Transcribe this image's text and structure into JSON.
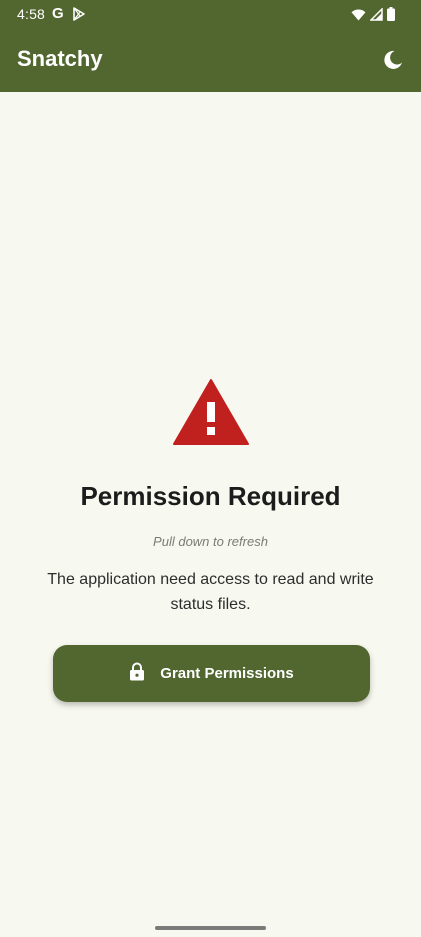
{
  "status_bar": {
    "time": "4:58",
    "left_icons": [
      "google-g-icon",
      "play-store-icon"
    ],
    "right_icons": [
      "wifi-icon",
      "signal-icon",
      "battery-icon"
    ]
  },
  "app_bar": {
    "title": "Snatchy",
    "theme_toggle_icon": "moon-icon"
  },
  "main": {
    "icon": "warning-triangle-icon",
    "icon_color": "#C0211F",
    "title": "Permission Required",
    "hint": "Pull down to refresh",
    "description": "The application need access to read and write status files.",
    "button": {
      "label": "Grant Permissions",
      "icon": "lock-icon"
    }
  },
  "colors": {
    "primary": "#526730",
    "background": "#F7F8EF",
    "warning": "#C0211F"
  }
}
